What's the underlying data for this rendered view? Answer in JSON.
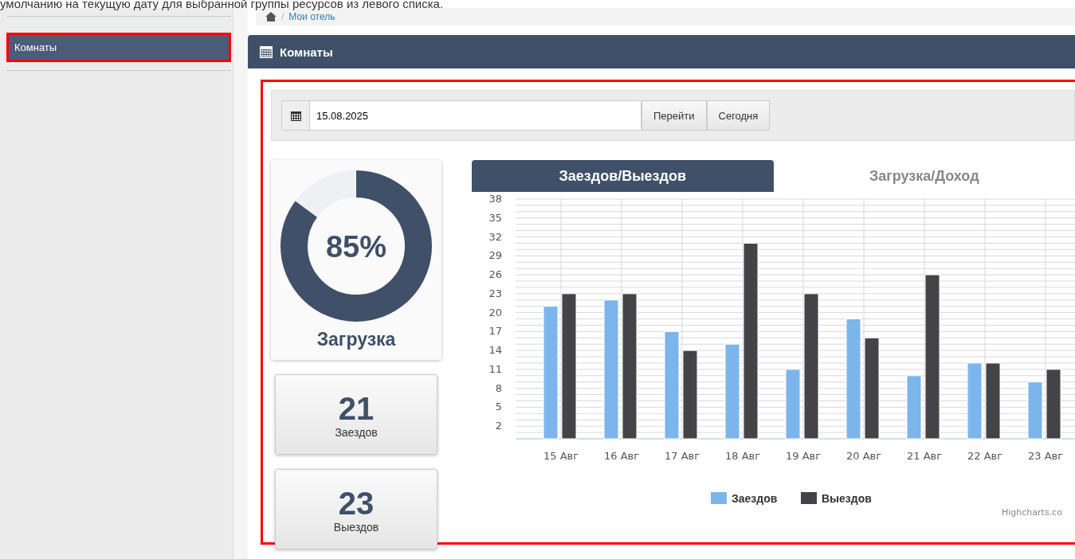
{
  "intro_text": "умолчанию на текущую дату для выбранной группы ресурсов из левого списка.",
  "sidebar": {
    "items": [
      {
        "label": "Комнаты",
        "selected": true,
        "highlighted": true
      }
    ]
  },
  "breadcrumb": {
    "separator": "/",
    "items": [
      "Мои отель"
    ]
  },
  "panel": {
    "title": "Комнаты",
    "highlighted": true
  },
  "toolbar": {
    "date": "15.08.2025",
    "buttons": [
      "Перейти",
      "Сегодня"
    ]
  },
  "occupancy": {
    "value": "85%",
    "level": 0.85,
    "label": "Загрузка"
  },
  "stats": [
    {
      "value": "21",
      "label": "Заездов"
    },
    {
      "value": "23",
      "label": "Выездов"
    }
  ],
  "chart_tabs": [
    {
      "label": "Заездов/Выездов",
      "selected": true
    },
    {
      "label": "Загрузка/Доход",
      "selected": false
    }
  ],
  "chart": {
    "credit": "Highcharts.co",
    "chart_data": {
      "type": "bar",
      "categories": [
        "15 Авг",
        "16 Авг",
        "17 Авг",
        "18 Авг",
        "19 Авг",
        "20 Авг",
        "21 Авг",
        "22 Авг",
        "23 Авг"
      ],
      "series": [
        {
          "name": "Заездов",
          "color": "#7cb5ec",
          "values": [
            21,
            22,
            17,
            15,
            11,
            19,
            10,
            12,
            9
          ]
        },
        {
          "name": "Выездов",
          "color": "#434348",
          "values": [
            23,
            23,
            14,
            31,
            23,
            16,
            26,
            12,
            11
          ]
        }
      ],
      "grid": true,
      "legend": true,
      "ylim": [
        0,
        38
      ],
      "yticks": [
        2,
        5,
        8,
        11,
        14,
        17,
        20,
        23,
        26,
        29,
        32,
        35,
        38
      ]
    }
  }
}
